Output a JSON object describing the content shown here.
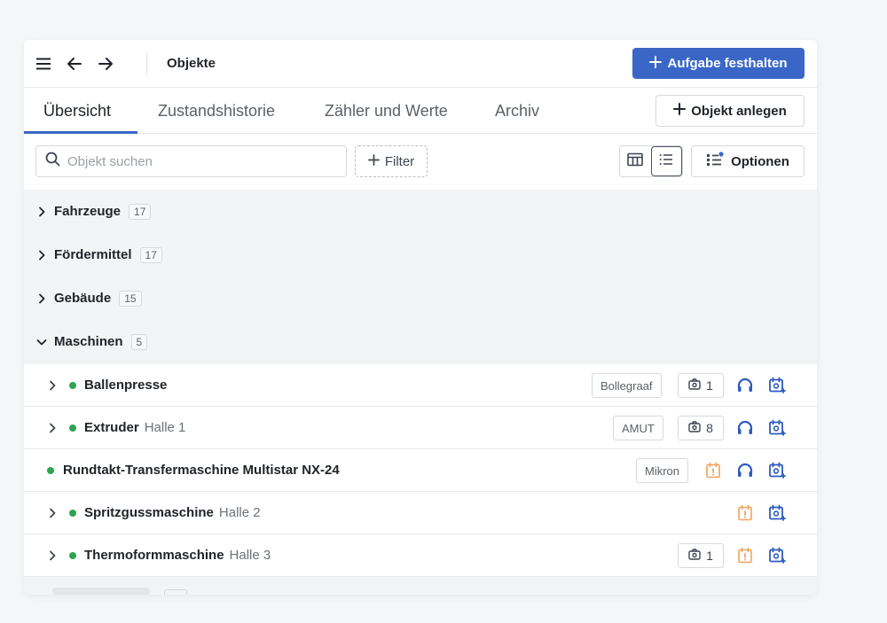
{
  "topbar": {
    "title": "Objekte",
    "primary_action_label": "Aufgabe festhalten",
    "accent_color": "#3a67c7"
  },
  "tabs": [
    {
      "label": "Übersicht",
      "active": true
    },
    {
      "label": "Zustandshistorie",
      "active": false
    },
    {
      "label": "Zähler und Werte",
      "active": false
    },
    {
      "label": "Archiv",
      "active": false
    }
  ],
  "create_object_label": "Objekt anlegen",
  "toolbar": {
    "search_placeholder": "Objekt suchen",
    "filter_label": "Filter",
    "options_label": "Optionen",
    "active_view": "list"
  },
  "groups": [
    {
      "label": "Fahrzeuge",
      "count": "17",
      "expanded": false
    },
    {
      "label": "Fördermittel",
      "count": "17",
      "expanded": false
    },
    {
      "label": "Gebäude",
      "count": "15",
      "expanded": false
    },
    {
      "label": "Maschinen",
      "count": "5",
      "expanded": true
    }
  ],
  "objects": [
    {
      "name": "Ballenpresse",
      "location": "",
      "brand": "Bollegraaf",
      "photos": "1",
      "status": "green",
      "has_children": true,
      "warning": false,
      "support": true
    },
    {
      "name": "Extruder",
      "location": "Halle 1",
      "brand": "AMUT",
      "photos": "8",
      "status": "green",
      "has_children": true,
      "warning": false,
      "support": true
    },
    {
      "name": "Rundtakt-Transfermaschine Multistar NX-24",
      "location": "",
      "brand": "Mikron",
      "photos": "",
      "status": "green",
      "has_children": false,
      "warning": true,
      "support": true
    },
    {
      "name": "Spritzgussmaschine",
      "location": "Halle 2",
      "brand": "",
      "photos": "",
      "status": "green",
      "has_children": true,
      "warning": true,
      "support": false
    },
    {
      "name": "Thermoformmaschine",
      "location": "Halle 3",
      "brand": "",
      "photos": "1",
      "status": "green",
      "has_children": true,
      "warning": true,
      "support": false
    }
  ],
  "icons": {
    "menu": "hamburger-icon",
    "back": "arrow-left-icon",
    "forward": "arrow-right-icon",
    "search": "search-icon",
    "table_view": "table-icon",
    "list_view": "list-icon",
    "options": "options-icon",
    "photo": "camera-icon",
    "support": "headset-icon",
    "schedule": "calendar-gear-icon",
    "warning": "warning-calendar-icon"
  },
  "colors": {
    "status_ok": "#2ea44f",
    "warning": "#f0a35a",
    "action_blue": "#3a67c7"
  }
}
